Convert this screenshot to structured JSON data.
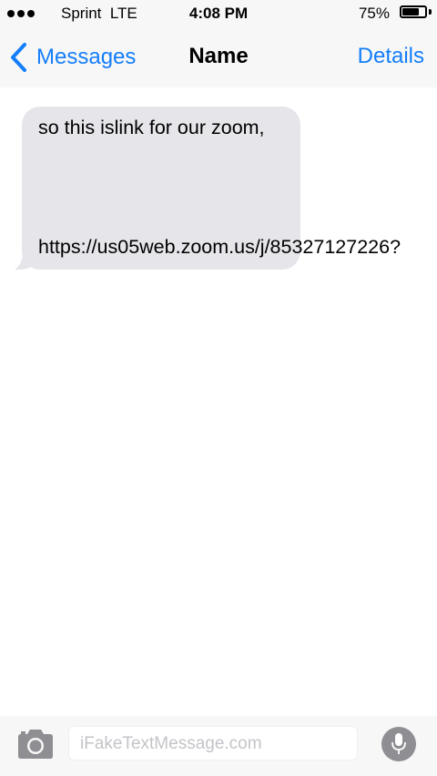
{
  "status_bar": {
    "carrier": "Sprint  LTE",
    "time": "4:08 PM",
    "battery_percent_label": "75%",
    "battery_level": 0.75
  },
  "nav": {
    "back_label": "Messages",
    "title": "Name",
    "details_label": "Details"
  },
  "conversation": {
    "messages": [
      {
        "direction": "incoming",
        "text": "so this islink for our zoom,",
        "link": "https://us05web.zoom.us/j/85327127226?"
      }
    ]
  },
  "input_bar": {
    "placeholder": "iFakeTextMessage.com"
  },
  "colors": {
    "accent": "#147efb",
    "bubble_incoming": "#e5e5ea",
    "bar_background": "#f7f7f7",
    "mic_button": "#8e8e93"
  },
  "icons": {
    "signal": "signal-dots-icon",
    "battery": "battery-icon",
    "back": "chevron-left-icon",
    "camera": "camera-icon",
    "microphone": "microphone-icon"
  }
}
